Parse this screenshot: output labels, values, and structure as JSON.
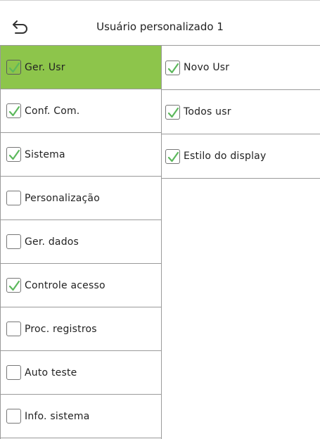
{
  "header": {
    "title": "Usuário personalizado 1",
    "back_icon": "back-arrow-icon"
  },
  "colors": {
    "selected_bg": "#8dc54b",
    "check": "#5cb85c"
  },
  "menu": [
    {
      "label": "Ger. Usr",
      "checked": true,
      "selected": true
    },
    {
      "label": "Conf. Com.",
      "checked": true,
      "selected": false
    },
    {
      "label": "Sistema",
      "checked": true,
      "selected": false
    },
    {
      "label": "Personalização",
      "checked": false,
      "selected": false
    },
    {
      "label": "Ger. dados",
      "checked": false,
      "selected": false
    },
    {
      "label": "Controle acesso",
      "checked": true,
      "selected": false
    },
    {
      "label": "Proc. registros",
      "checked": false,
      "selected": false
    },
    {
      "label": "Auto teste",
      "checked": false,
      "selected": false
    },
    {
      "label": "Info. sistema",
      "checked": false,
      "selected": false
    }
  ],
  "submenu": [
    {
      "label": "Novo Usr",
      "checked": true
    },
    {
      "label": "Todos usr",
      "checked": true
    },
    {
      "label": "Estilo do display",
      "checked": true
    }
  ]
}
